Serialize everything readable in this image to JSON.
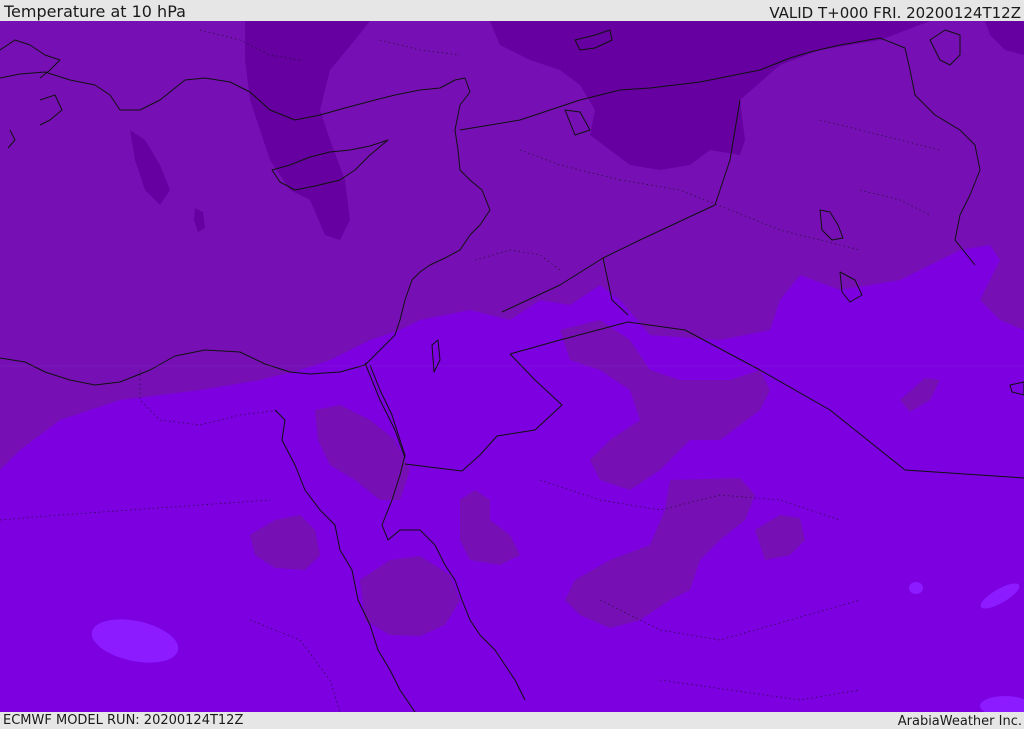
{
  "header": {
    "title": "Temperature at 10 hPa",
    "valid": "VALID T+000 FRI. 20200124T12Z"
  },
  "footer": {
    "model_run": "ECMWF MODEL RUN: 20200124T12Z",
    "credit": "ArabiaWeather Inc."
  },
  "map": {
    "field": "temperature",
    "level": "10 hPa",
    "colors": {
      "warmest": "#7c00e0",
      "warm": "#7610b4",
      "cold": "#6600a0",
      "bright": "#8c1cff",
      "border": "#111111"
    }
  }
}
